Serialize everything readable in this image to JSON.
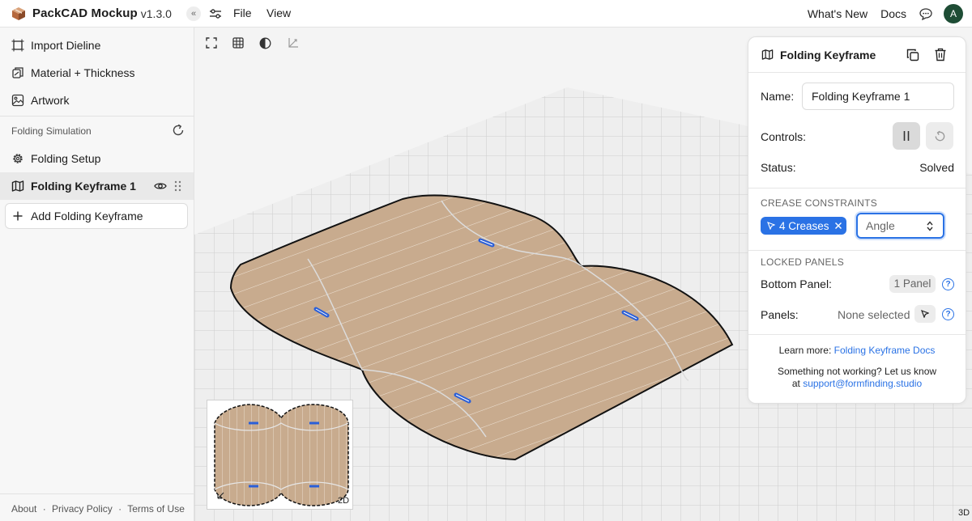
{
  "app": {
    "name": "PackCAD Mockup",
    "version": "v1.3.0"
  },
  "topbar": {
    "collapse_glyph": "«",
    "menu": [
      "File",
      "View"
    ],
    "right_links": [
      "What's New",
      "Docs"
    ],
    "avatar_initial": "A"
  },
  "sidebar": {
    "items": [
      {
        "label": "Import Dieline",
        "icon": "import-icon"
      },
      {
        "label": "Material + Thickness",
        "icon": "material-icon"
      },
      {
        "label": "Artwork",
        "icon": "image-icon"
      }
    ],
    "section_title": "Folding Simulation",
    "folding_items": [
      {
        "label": "Folding Setup",
        "icon": "gear-icon"
      },
      {
        "label": "Folding Keyframe 1",
        "icon": "map-icon",
        "active": true
      }
    ],
    "add_button": "Add Folding Keyframe",
    "footer": [
      "About",
      "·",
      "Privacy Policy",
      "·",
      "Terms of Use"
    ]
  },
  "panel": {
    "title": "Folding Keyframe",
    "name_label": "Name:",
    "name_value": "Folding Keyframe 1",
    "controls_label": "Controls:",
    "status_label": "Status:",
    "status_value": "Solved",
    "crease_title": "CREASE CONSTRAINTS",
    "crease_chip": "4 Creases",
    "angle_placeholder": "Angle",
    "locked_title": "LOCKED PANELS",
    "bottom_panel_label": "Bottom Panel:",
    "bottom_panel_value": "1 Panel",
    "panels_label": "Panels:",
    "panels_value": "None selected",
    "learn_prefix": "Learn more:",
    "learn_link": "Folding Keyframe Docs",
    "help_line1": "Something not working? Let us know",
    "help_prefix": "at",
    "help_email": "support@formfinding.studio"
  },
  "viewport": {
    "label_2d": "2D",
    "label_3d": "3D",
    "material_color": "#c8ab8e",
    "crease_color": "#2a5fd8",
    "accent": "#2a72e5"
  }
}
